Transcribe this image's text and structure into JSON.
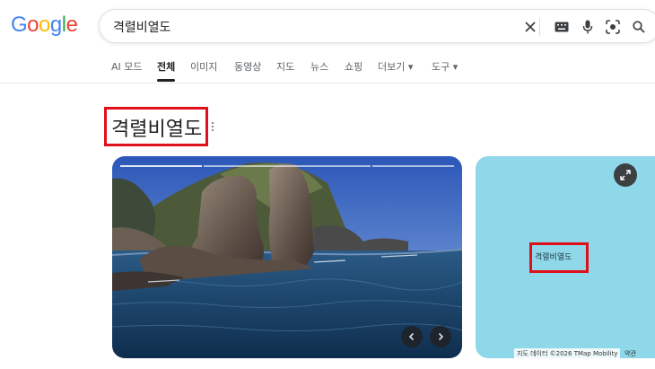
{
  "logo": {
    "letters": [
      "G",
      "o",
      "o",
      "g",
      "l",
      "e"
    ],
    "colors": [
      "#4285F4",
      "#EA4335",
      "#FBBC05",
      "#4285F4",
      "#34A853",
      "#EA4335"
    ]
  },
  "search": {
    "query": "격렬비열도"
  },
  "tabs": [
    {
      "label": "AI 모드",
      "active": false
    },
    {
      "label": "전체",
      "active": true
    },
    {
      "label": "이미지",
      "active": false
    },
    {
      "label": "동영상",
      "active": false
    },
    {
      "label": "지도",
      "active": false
    },
    {
      "label": "뉴스",
      "active": false
    },
    {
      "label": "쇼핑",
      "active": false
    },
    {
      "label": "더보기 ▾",
      "active": false
    },
    {
      "label": "도구 ▾",
      "active": false
    }
  ],
  "knowledge_panel": {
    "title": "격렬비열도"
  },
  "map": {
    "place_label": "격렬비열도",
    "attribution": "지도 데이터 ©2026 TMap Mobility",
    "terms": "약관"
  },
  "colors": {
    "highlight": "#e0101b",
    "sea": "#8fd8ea"
  }
}
